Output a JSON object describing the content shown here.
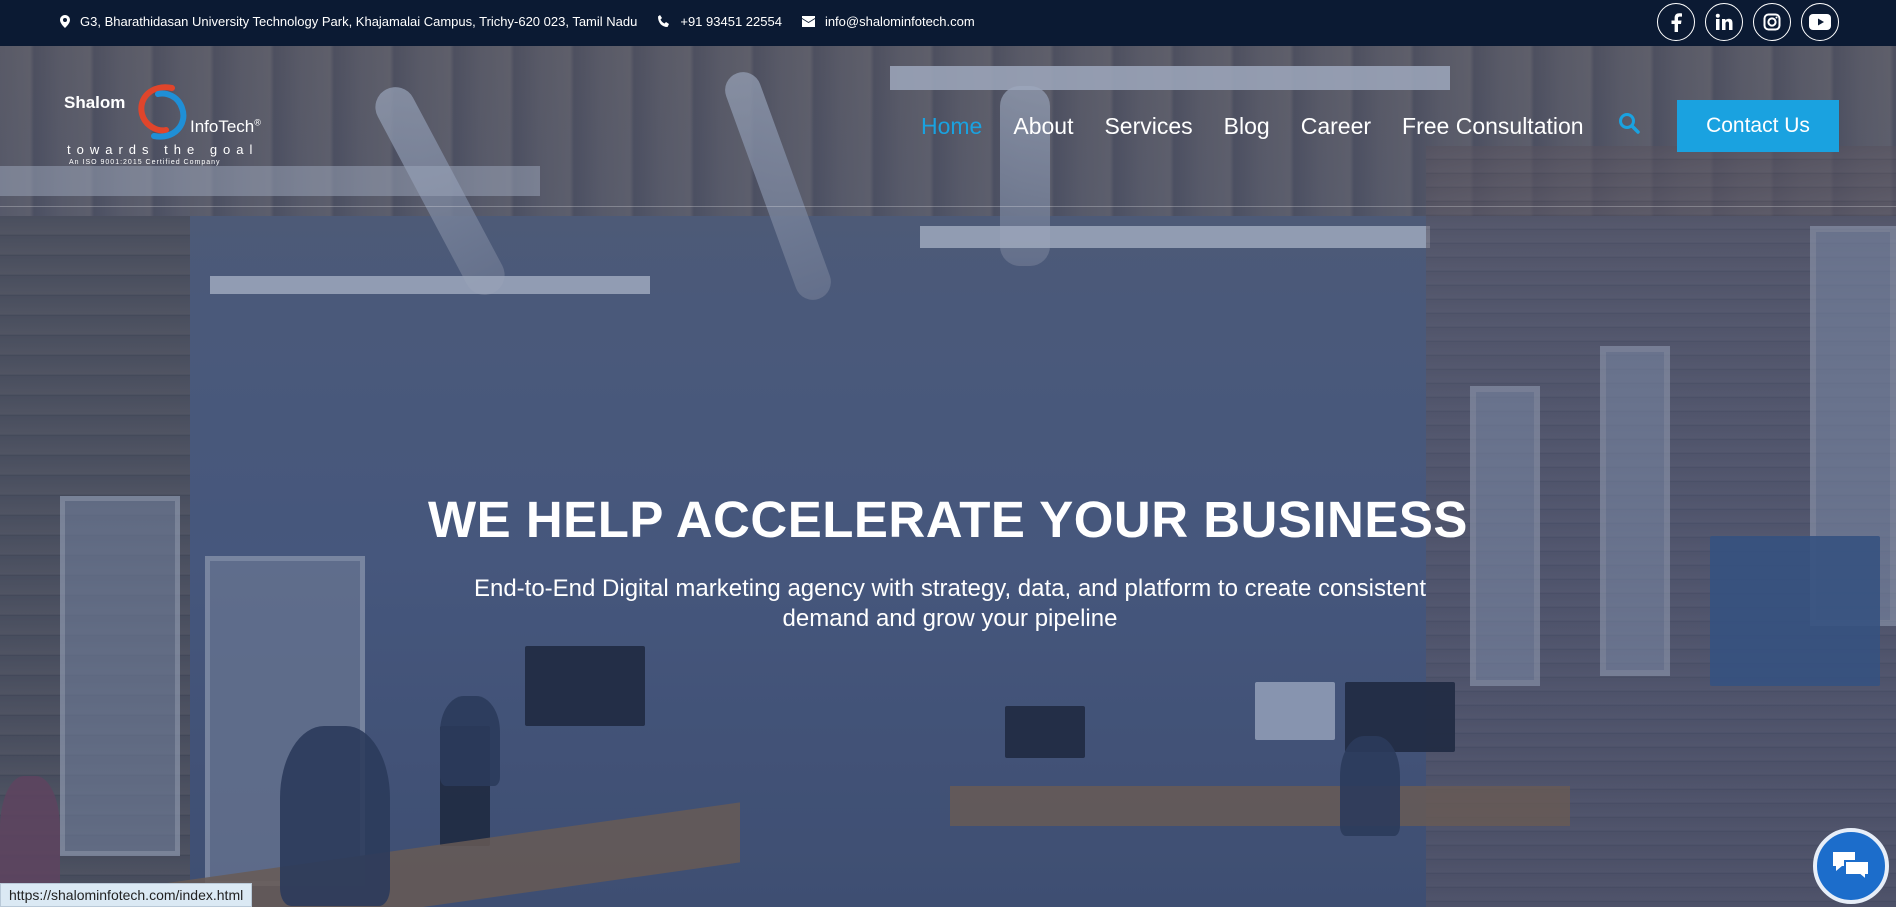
{
  "topbar": {
    "address": "G3, Bharathidasan University Technology Park, Khajamalai Campus, Trichy-620 023, Tamil Nadu",
    "phone": "+91 93451 22554",
    "email": "info@shalominfotech.com",
    "social": [
      {
        "icon": "facebook-icon"
      },
      {
        "icon": "linkedin-icon"
      },
      {
        "icon": "instagram-icon"
      },
      {
        "icon": "youtube-icon"
      }
    ]
  },
  "logo": {
    "word1": "Shalom",
    "word2": "InfoTech",
    "registered": "®",
    "tagline": "towards the goal",
    "certification": "An ISO 9001:2015 Certified Company"
  },
  "nav": {
    "items": [
      "Home",
      "About",
      "Services",
      "Blog",
      "Career",
      "Free Consultation"
    ],
    "active": "Home",
    "contact_label": "Contact Us"
  },
  "hero": {
    "headline": "WE HELP ACCELERATE YOUR BUSINESS",
    "subline": "End-to-End Digital marketing agency with strategy, data, and platform to create consistent demand and grow your pipeline"
  },
  "status_bar": {
    "url": "https://shalominfotech.com/index.html"
  },
  "colors": {
    "accent": "#1aa2e0",
    "topbar_bg": "#0b1a33",
    "chat_button": "#1c6dcb"
  }
}
